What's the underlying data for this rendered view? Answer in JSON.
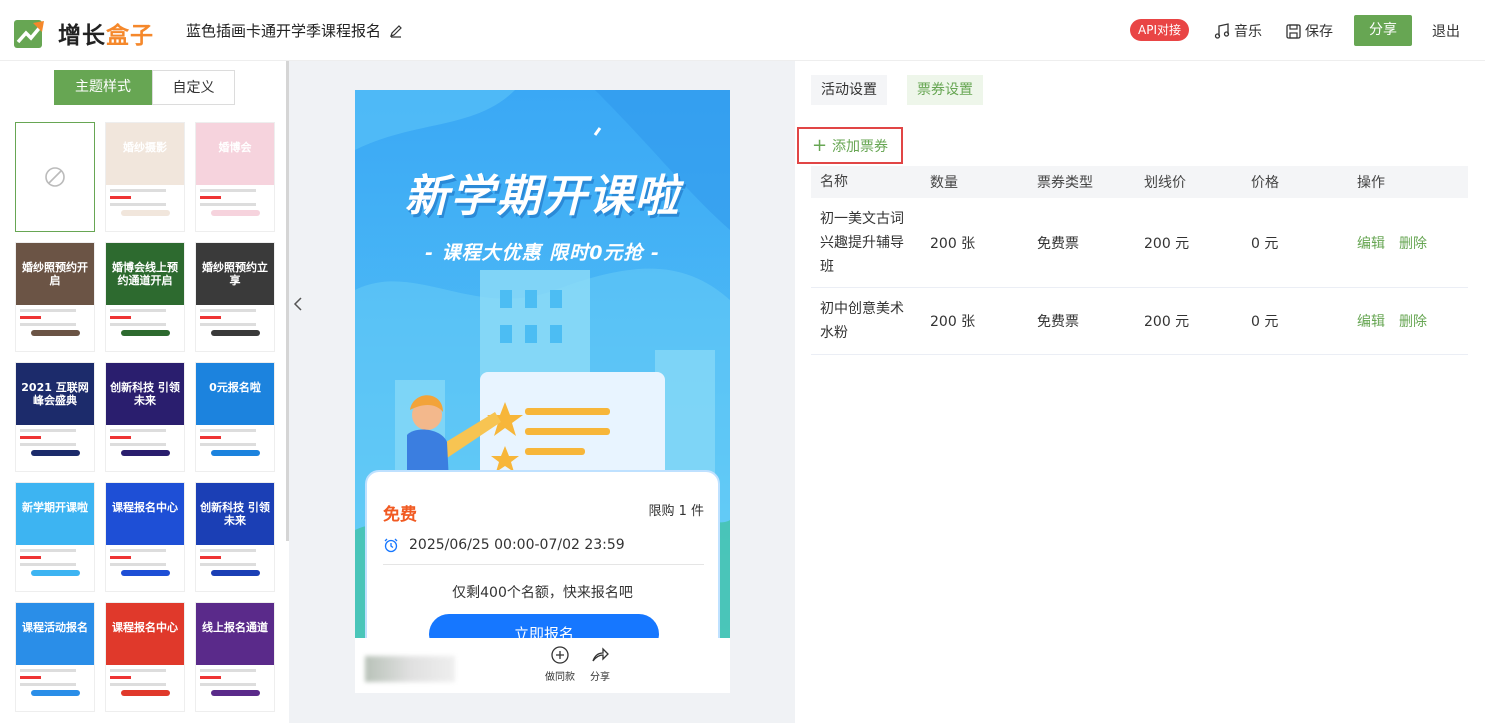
{
  "header": {
    "logo_a": "增长",
    "logo_b": "盒子",
    "page_title": "蓝色插画卡通开学季课程报名",
    "api_badge": "API对接",
    "music": "音乐",
    "save": "保存",
    "share": "分享",
    "logout": "退出"
  },
  "left": {
    "tabs": [
      "主题样式",
      "自定义"
    ],
    "templates": [
      {
        "title": "",
        "color": "#ffffff"
      },
      {
        "title": "婚纱摄影",
        "color": "#f1e6dc"
      },
      {
        "title": "婚博会",
        "color": "#f6d3dd"
      },
      {
        "title": "婚纱照预约开启",
        "color": "#6b5445"
      },
      {
        "title": "婚博会线上预约通道开启",
        "color": "#2d6a2f"
      },
      {
        "title": "婚纱照预约立享",
        "color": "#3a3a3a"
      },
      {
        "title": "2021 互联网峰会盛典",
        "color": "#1c2b6b"
      },
      {
        "title": "创新科技 引领未来",
        "color": "#2a1e6e"
      },
      {
        "title": "0元报名啦",
        "color": "#1c83de"
      },
      {
        "title": "新学期开课啦",
        "color": "#3db4f2"
      },
      {
        "title": "课程报名中心",
        "color": "#1e4fd6"
      },
      {
        "title": "创新科技 引领未来",
        "color": "#1b3fb5"
      },
      {
        "title": "课程活动报名",
        "color": "#2a8ee8"
      },
      {
        "title": "课程报名中心",
        "color": "#e0392b"
      },
      {
        "title": "线上报名通道",
        "color": "#5a2a8a"
      }
    ]
  },
  "preview": {
    "title": "新学期开课啦",
    "subtitle": "- 课程大优惠 限时0元抢 -",
    "ticket_price": "免费",
    "limit": "限购 1 件",
    "time": "2025/06/25 00:00-07/02 23:59",
    "remain": "仅剩400个名额，快来报名吧",
    "signup": "立即报名",
    "copy_action": "做同款",
    "share_action": "分享"
  },
  "right": {
    "tabs": [
      "活动设置",
      "票券设置"
    ],
    "add_ticket": "添加票券",
    "columns": [
      "名称",
      "数量",
      "票券类型",
      "划线价",
      "价格",
      "操作"
    ],
    "rows": [
      {
        "name": "初一美文古词兴趣提升辅导班",
        "qty": "200 张",
        "type": "免费票",
        "orig": "200 元",
        "price": "0 元",
        "edit": "编辑",
        "del": "删除"
      },
      {
        "name": "初中创意美术水粉",
        "qty": "200 张",
        "type": "免费票",
        "orig": "200 元",
        "price": "0 元",
        "edit": "编辑",
        "del": "删除"
      }
    ]
  },
  "colors": {
    "accent": "#67a653",
    "danger": "#e94545",
    "brand": "#f5882b",
    "primary": "#1677ff"
  }
}
